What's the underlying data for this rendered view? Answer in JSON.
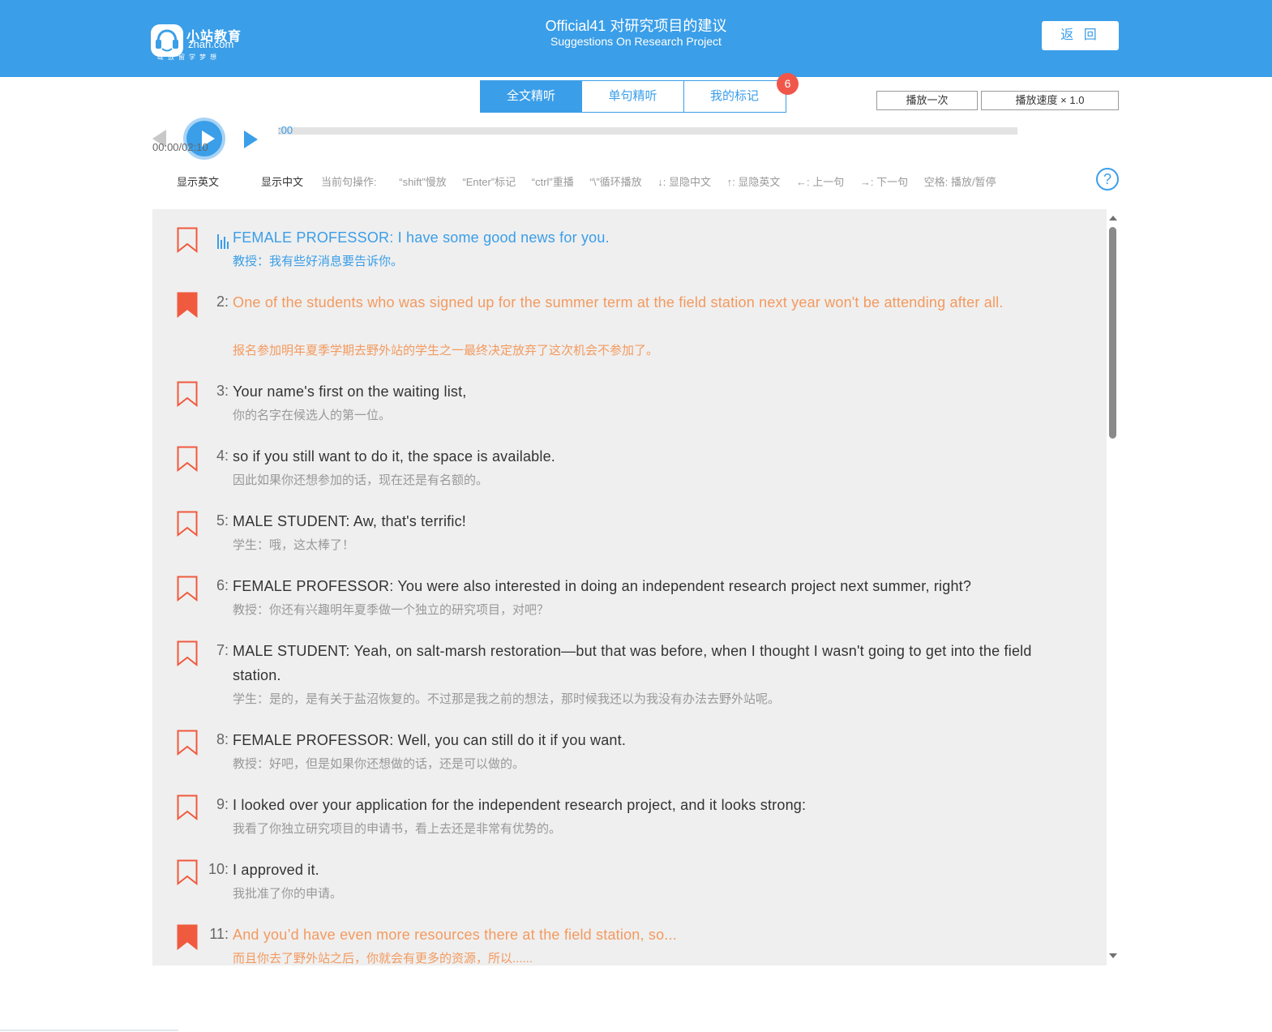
{
  "header": {
    "logo": {
      "cn": "小站教育",
      "en": "zhan.com",
      "slogan": "绽放留学梦想"
    },
    "title_cn": "Official41 对研究项目的建议",
    "title_en": "Suggestions On Research Project",
    "back_label": "返 回"
  },
  "tabs": [
    {
      "label": "全文精听",
      "active": true
    },
    {
      "label": "单句精听",
      "active": false
    },
    {
      "label": "我的标记",
      "active": false
    }
  ],
  "tab_badge": "6",
  "options": {
    "play_once": "播放一次",
    "speed": "播放速度 × 1.0"
  },
  "player": {
    "time": "00:00/02:10",
    "progress_label": ":00",
    "progress": 0
  },
  "toggles": {
    "show_en": "显示英文",
    "show_cn": "显示中文"
  },
  "shortcuts": {
    "label": "当前句操作:",
    "items": [
      "“shift”慢放",
      "“Enter”标记",
      "“ctrl”重播",
      "“\\”循环播放",
      "↓: 显隐中文",
      "↑: 显隐英文",
      "←: 上一句",
      "→: 下一句",
      "空格: 播放/暂停"
    ]
  },
  "help_label": "?",
  "colors": {
    "primary": "#3a9ee8",
    "marked": "#f39a5f",
    "bookmark": "#f05a3e",
    "panel_bg": "#efefef"
  },
  "sentences": [
    {
      "num": "",
      "en": "FEMALE PROFESSOR: I have some good news for you.",
      "cn": "教授：我有些好消息要告诉你。",
      "state": "playing",
      "bookmarked": false
    },
    {
      "num": "2:",
      "en": "One of the students who was signed up for the summer term at the field station next year won't be attending after all.",
      "cn": "报名参加明年夏季学期去野外站的学生之一最终决定放弃了这次机会不参加了。",
      "state": "marked",
      "bookmarked": true
    },
    {
      "num": "3:",
      "en": "Your name's first on the waiting list,",
      "cn": "你的名字在候选人的第一位。",
      "state": "",
      "bookmarked": false
    },
    {
      "num": "4:",
      "en": "so if you still want to do it, the space is available.",
      "cn": "因此如果你还想参加的话，现在还是有名额的。",
      "state": "",
      "bookmarked": false
    },
    {
      "num": "5:",
      "en": "MALE STUDENT: Aw, that's terrific!",
      "cn": "学生：哦，这太棒了！",
      "state": "",
      "bookmarked": false
    },
    {
      "num": "6:",
      "en": "FEMALE PROFESSOR: You were also interested in doing an independent research project next summer, right?",
      "cn": "教授：你还有兴趣明年夏季做一个独立的研究项目，对吧？",
      "state": "",
      "bookmarked": false
    },
    {
      "num": "7:",
      "en": "MALE STUDENT: Yeah, on salt-marsh restoration—but that was before, when I thought I wasn't going to get into the field station.",
      "cn": "学生：是的，是有关于盐沼恢复的。不过那是我之前的想法，那时候我还以为我没有办法去野外站呢。",
      "state": "",
      "bookmarked": false
    },
    {
      "num": "8:",
      "en": "FEMALE PROFESSOR: Well, you can still do it if you want.",
      "cn": "教授：好吧，但是如果你还想做的话，还是可以做的。",
      "state": "",
      "bookmarked": false
    },
    {
      "num": "9:",
      "en": "I looked over your application for the independent research project, and it looks strong:",
      "cn": "我看了你独立研究项目的申请书，看上去还是非常有优势的。",
      "state": "",
      "bookmarked": false
    },
    {
      "num": "10:",
      "en": "I approved it.",
      "cn": "我批准了你的申请。",
      "state": "",
      "bookmarked": false
    },
    {
      "num": "11:",
      "en": "And you’d have even more resources there at the field station, so...",
      "cn": "而且你去了野外站之后，你就会有更多的资源，所以......",
      "state": "marked",
      "bookmarked": true
    }
  ]
}
